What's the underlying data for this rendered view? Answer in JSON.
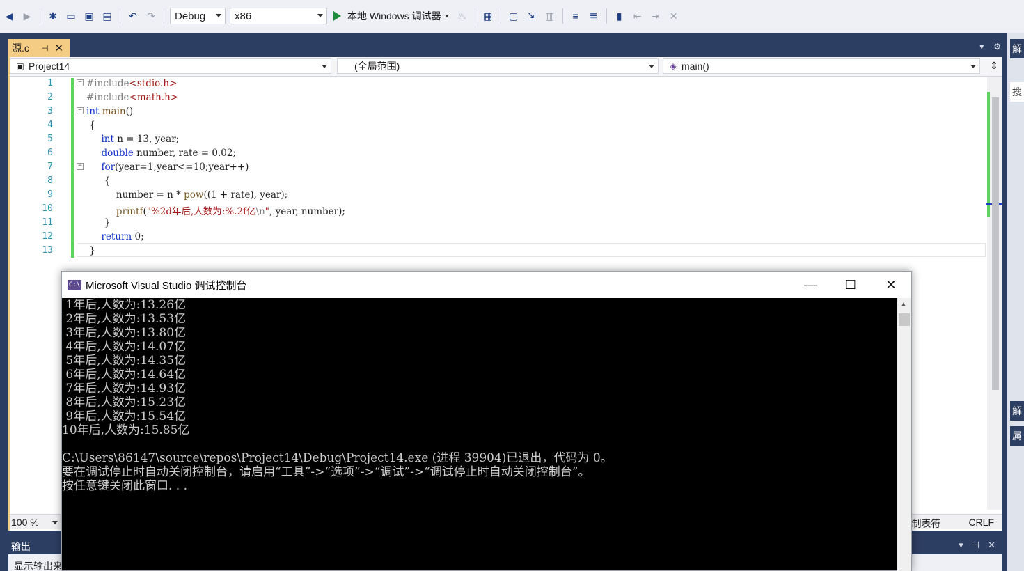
{
  "toolbar": {
    "config": "Debug",
    "platform": "x86",
    "run_label": "本地 Windows 调试器"
  },
  "tab": {
    "filename": "源.c",
    "pin": "⊣",
    "close": "✕"
  },
  "navbar": {
    "project": "Project14",
    "scope": "(全局范围)",
    "member": "main()"
  },
  "editor": {
    "lines": [
      "1",
      "2",
      "3",
      "4",
      "5",
      "6",
      "7",
      "8",
      "9",
      "10",
      "11",
      "12",
      "13"
    ],
    "zoom": "100 %",
    "tabs_mode": "制表符",
    "line_ending": "CRLF"
  },
  "side_panel": {
    "tab1": "解",
    "tab2": "搜",
    "tab3": "解",
    "tab4": "属"
  },
  "output": {
    "title": "输出",
    "show_output": "显示输出来"
  },
  "console": {
    "title": "Microsoft Visual Studio 调试控制台",
    "icon_text": "C:\\",
    "lines": [
      " 1年后,人数为:13.26亿",
      " 2年后,人数为:13.53亿",
      " 3年后,人数为:13.80亿",
      " 4年后,人数为:14.07亿",
      " 5年后,人数为:14.35亿",
      " 6年后,人数为:14.64亿",
      " 7年后,人数为:14.93亿",
      " 8年后,人数为:15.23亿",
      " 9年后,人数为:15.54亿",
      "10年后,人数为:15.85亿",
      "",
      "C:\\Users\\86147\\source\\repos\\Project14\\Debug\\Project14.exe (进程 39904)已退出，代码为 0。",
      "要在调试停止时自动关闭控制台，请启用“工具”->“选项”->“调试”->“调试停止时自动关闭控制台”。",
      "按任意键关闭此窗口. . ."
    ]
  }
}
